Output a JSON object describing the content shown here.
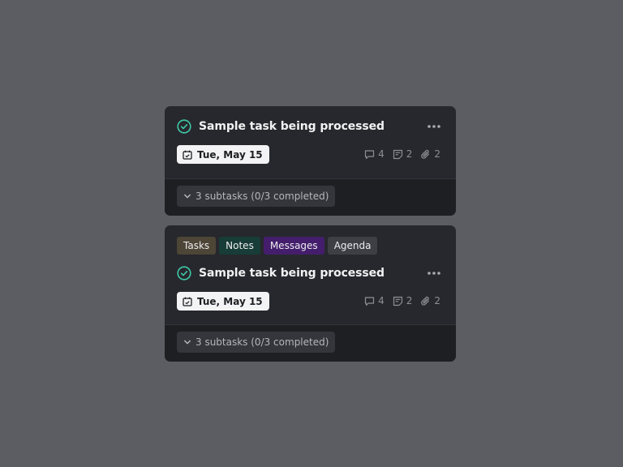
{
  "colors": {
    "background": "#5c5d63",
    "card": "#27282d",
    "card_footer": "#1e1f23",
    "check_accent": "#3fc9a8"
  },
  "cards": [
    {
      "tags": [],
      "title": "Sample task being processed",
      "date": "Tue, May 15",
      "comments": "4",
      "notes": "2",
      "attachments": "2",
      "subtasks": "3 subtasks (0/3 completed)"
    },
    {
      "tags": [
        {
          "label": "Tasks",
          "color": "#4d4536"
        },
        {
          "label": "Notes",
          "color": "#183c37"
        },
        {
          "label": "Messages",
          "color": "#441e6c"
        },
        {
          "label": "Agenda",
          "color": "#3e3f44"
        }
      ],
      "title": "Sample task being processed",
      "date": "Tue, May 15",
      "comments": "4",
      "notes": "2",
      "attachments": "2",
      "subtasks": "3 subtasks (0/3 completed)"
    }
  ],
  "icons": [
    "check-circle-icon",
    "more-horizontal-icon",
    "calendar-icon",
    "comment-icon",
    "note-icon",
    "paperclip-icon",
    "chevron-down-icon"
  ]
}
